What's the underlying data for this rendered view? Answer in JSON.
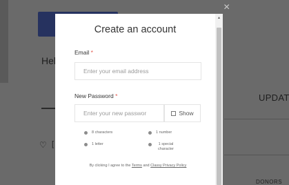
{
  "background": {
    "greeting_partial": "Hel",
    "tab_partial": "UPDAT",
    "footer_partial": "DONORS",
    "close_symbol": "×",
    "heart_symbol": "♡",
    "heart_suffix": "["
  },
  "modal": {
    "title": "Create an account",
    "email": {
      "label": "Email",
      "required_mark": "*",
      "placeholder": "Enter your email address"
    },
    "password": {
      "label": "New Password",
      "required_mark": "*",
      "placeholder": "Enter your new passwor",
      "show_label": "Show"
    },
    "requirements": [
      "8 characters",
      "1 number",
      "1 letter",
      "1 special character"
    ],
    "terms": {
      "prefix": "By clicking I agree to the",
      "terms_link": "Terms",
      "and": "and",
      "privacy_link": "Classy Privacy Policy"
    },
    "scroll_up_symbol": "▲"
  },
  "colors": {
    "overlay_bg": "#6a6a6a",
    "brand_button": "#26325f",
    "required": "#e2574c"
  },
  "icons": [
    "close-icon",
    "heart-icon",
    "checkbox-icon",
    "bullet-icon",
    "scroll-up-icon"
  ]
}
